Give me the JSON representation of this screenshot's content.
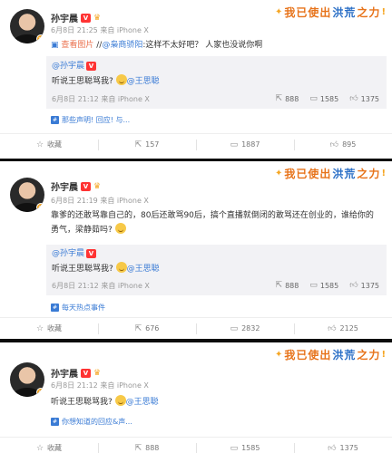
{
  "sticker": {
    "text_a": "我已使出",
    "text_b": "洪荒",
    "text_c": "之力"
  },
  "posts": [
    {
      "author": "孙宇晨",
      "vip": "V",
      "meta": "6月8日 21:25 来自 iPhone X",
      "body_prefix": "查看图片",
      "body_sep": " //",
      "body_at": "@枭商骄阳",
      "body_rest": ":这样不太好吧？ 人家也没说你啊",
      "repost": {
        "at": "@孙宇晨",
        "text_a": "听说王思聪骂我?",
        "text_b": "@王思聪",
        "meta": "6月8日 21:12 来自 iPhone X",
        "reposts": "888",
        "comments": "1585",
        "likes": "1375"
      },
      "topic": "那些声明! 回应! 与...",
      "actions": {
        "fav": "收藏",
        "repost": "157",
        "comment": "1887",
        "like": "895"
      }
    },
    {
      "author": "孙宇晨",
      "vip": "V",
      "meta": "6月8日 21:19 来自 iPhone X",
      "body": "靠爹的还敢骂靠自己的，80后还敢骂90后，搞个直播就倒闭的敢骂还在创业的，谁给你的勇气，梁静茹吗?",
      "repost": {
        "at": "@孙宇晨",
        "text_a": "听说王思聪骂我?",
        "text_b": "@王思聪",
        "meta": "6月8日 21:12 来自 iPhone X",
        "reposts": "888",
        "comments": "1585",
        "likes": "1375"
      },
      "topic": "每天热点事件",
      "actions": {
        "fav": "收藏",
        "repost": "676",
        "comment": "2832",
        "like": "2125"
      }
    },
    {
      "author": "孙宇晨",
      "vip": "V",
      "meta": "6月8日 21:12 来自 iPhone X",
      "body_a": "听说王思聪骂我?",
      "body_b": "@王思聪",
      "topic": "你想知道的回应&声...",
      "actions": {
        "fav": "收藏",
        "repost": "888",
        "comment": "1585",
        "like": "1375"
      }
    }
  ]
}
